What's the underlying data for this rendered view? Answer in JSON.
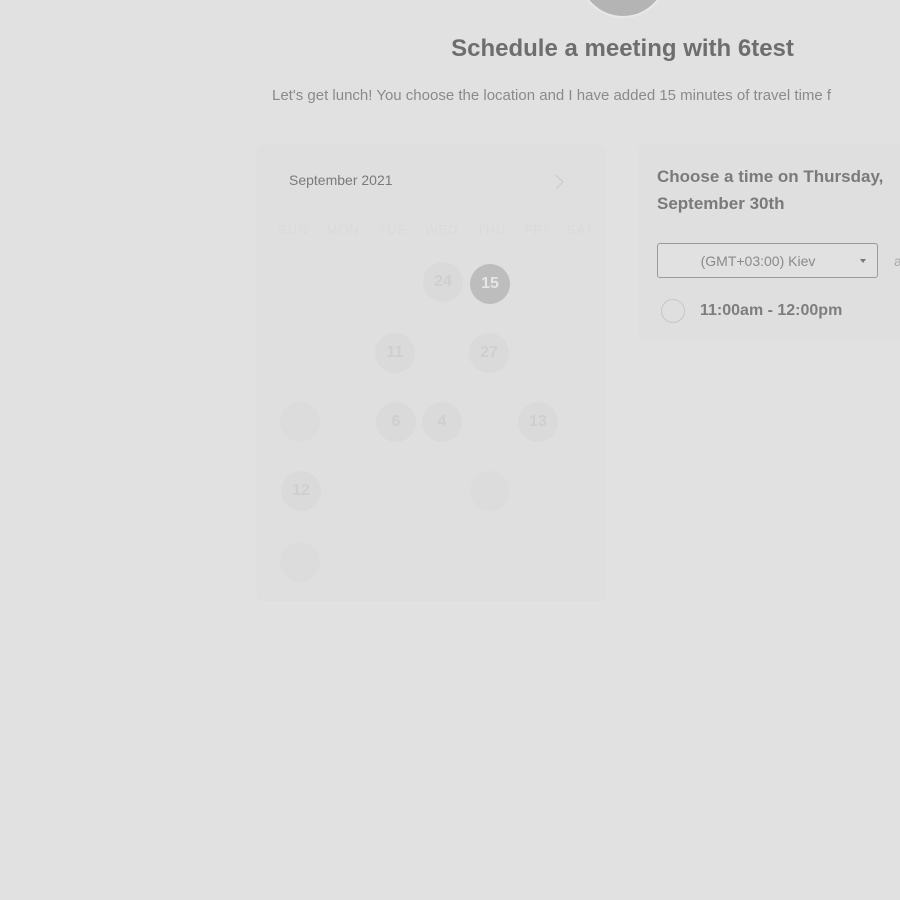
{
  "header": {
    "title": "Schedule a meeting with 6test",
    "subtitle": "Let's get lunch! You choose the location and I have added 15 minutes of travel time f"
  },
  "calendar": {
    "month_label": "September 2021",
    "weekdays": [
      "SUN",
      "MON",
      "TUE",
      "WED",
      "THU",
      "FRI",
      "SAT"
    ],
    "days": [
      {
        "label": "24",
        "style": "normal"
      },
      {
        "label": "15",
        "style": "selected"
      },
      {
        "label": "11",
        "style": "normal"
      },
      {
        "label": "27",
        "style": "normal"
      },
      {
        "label": "6",
        "style": "normal"
      },
      {
        "label": "4",
        "style": "normal"
      },
      {
        "label": "13",
        "style": "normal"
      },
      {
        "label": "12",
        "style": "normal"
      },
      {
        "label": "",
        "style": "ghost"
      },
      {
        "label": "",
        "style": "ghost"
      },
      {
        "label": "",
        "style": "ghost"
      }
    ]
  },
  "times": {
    "heading": "Choose a time on Thursday, September 30th",
    "timezone": "(GMT+03:00) Kiev",
    "timezone_side": "a",
    "slots": [
      "11:00am - 12:00pm"
    ]
  },
  "icons": {
    "next_month": "chevron-right-icon",
    "timezone_dropdown": "caret-down-icon"
  },
  "colors": {
    "background": "#e1e1e1",
    "selected_day": "#bdbdbd",
    "heading_text": "#6e6e6e"
  }
}
